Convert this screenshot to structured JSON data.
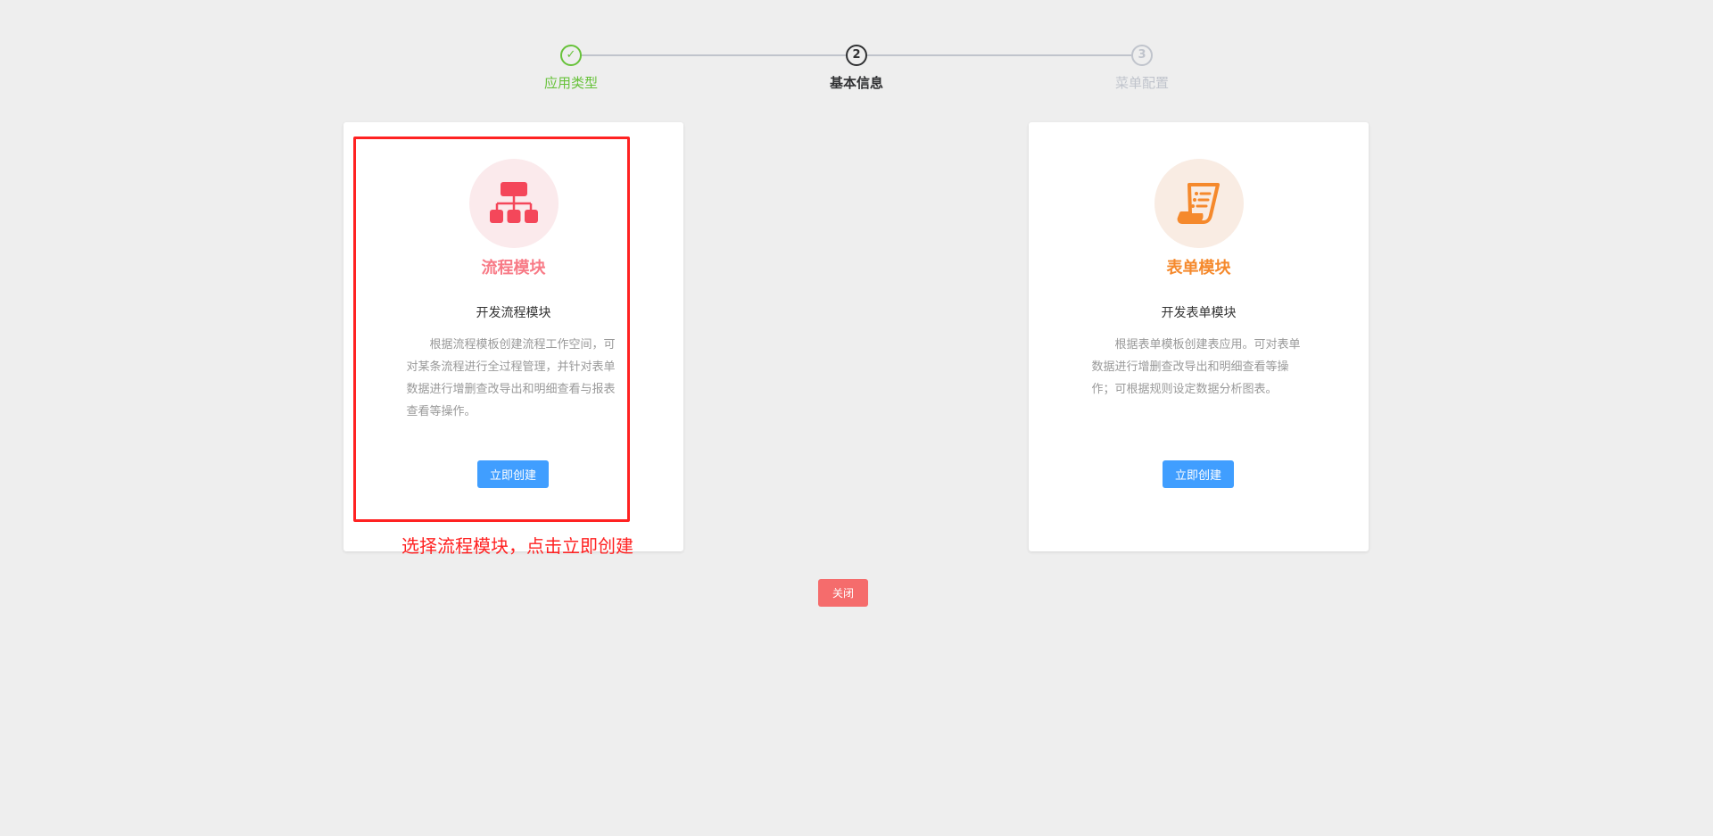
{
  "steps": [
    {
      "label": "应用类型",
      "status": "done",
      "color": "#67c23a"
    },
    {
      "label": "基本信息",
      "number": "2",
      "status": "active",
      "color": "#303133"
    },
    {
      "label": "菜单配置",
      "number": "3",
      "status": "pending",
      "color": "#c0c4cc"
    }
  ],
  "cards": [
    {
      "title": "流程模块",
      "subtitle": "开发流程模块",
      "description": "根据流程模板创建流程工作空间，可对某条流程进行全过程管理，并针对表单数据进行增删查改导出和明细查看与报表查看等操作。",
      "button": "立即创建",
      "icon": "org-chart-icon",
      "color": "#f4475a"
    },
    {
      "title": "表单模块",
      "subtitle": "开发表单模块",
      "description": "根据表单模板创建表应用。可对表单数据进行增删查改导出和明细查看等操作；可根据规则设定数据分析图表。",
      "button": "立即创建",
      "icon": "document-list-icon",
      "color": "#f5892c"
    }
  ],
  "annotation": "选择流程模块，点击立即创建",
  "close_label": "关闭"
}
